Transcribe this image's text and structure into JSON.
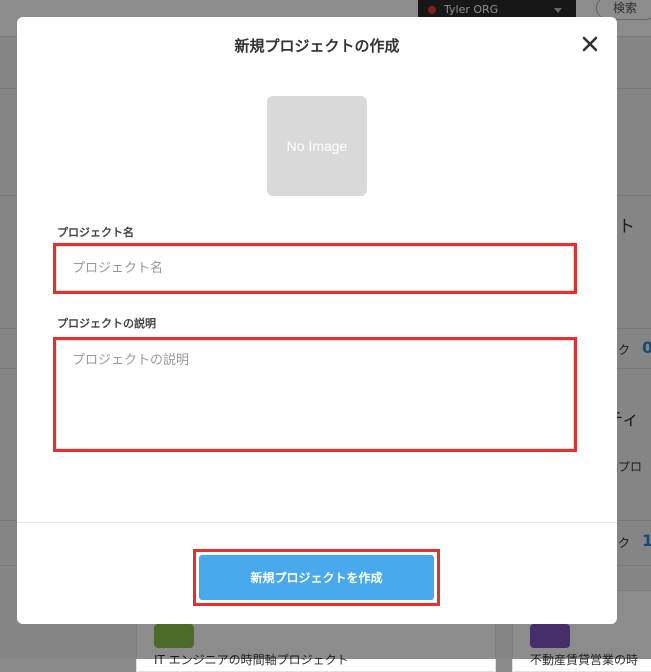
{
  "background": {
    "org_name": "Tyler ORG",
    "search_label": "検索",
    "card_fragments": [
      "ト",
      "スク",
      "0",
      "ティ",
      "軸プロ",
      "スク",
      "1",
      "営業",
      "IT エンジニアの時間軸プロジェクト",
      "不動産賃貸営業の時"
    ]
  },
  "modal": {
    "title": "新規プロジェクトの作成",
    "image_placeholder": "No Image",
    "project_name": {
      "label": "プロジェクト名",
      "placeholder": "プロジェクト名",
      "value": ""
    },
    "project_description": {
      "label": "プロジェクトの説明",
      "placeholder": "プロジェクトの説明",
      "value": ""
    },
    "submit_label": "新規プロジェクトを作成"
  },
  "colors": {
    "primary_button": "#4aa8ec",
    "highlight": "#e53030",
    "overlay": "rgba(0,0,0,0.45)"
  }
}
